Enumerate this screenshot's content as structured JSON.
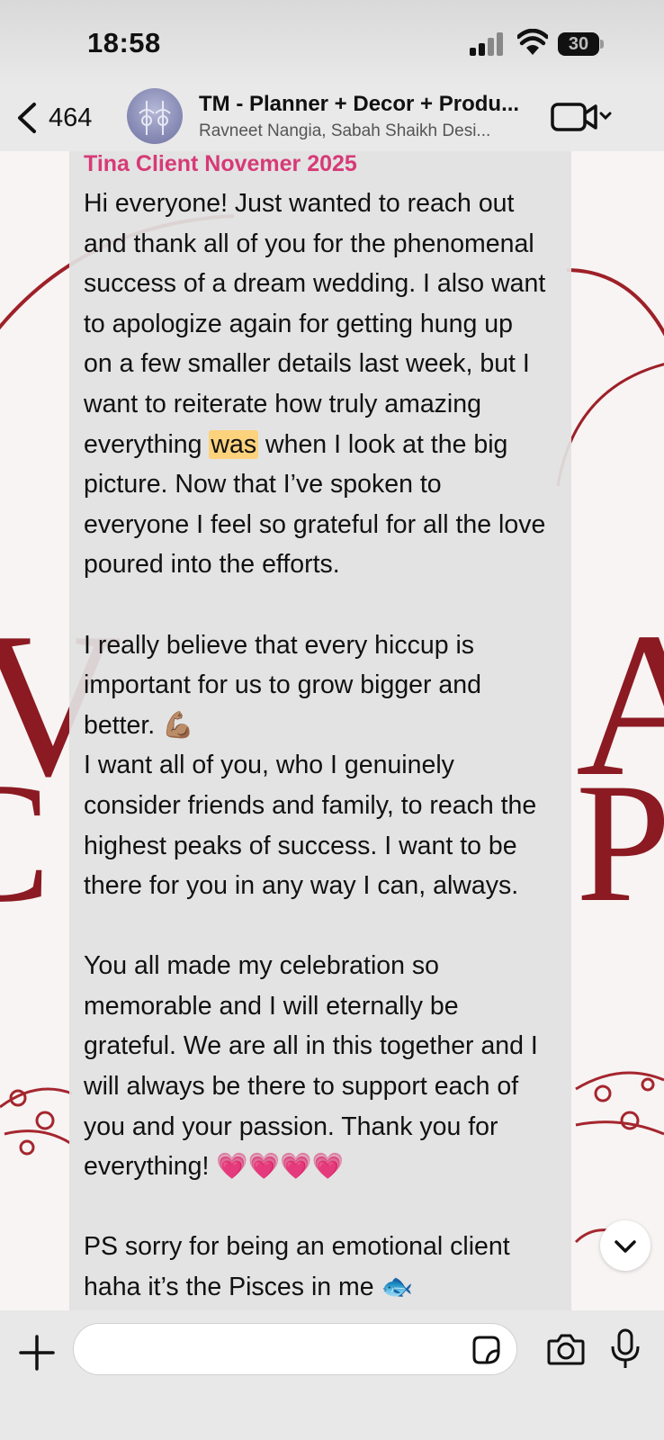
{
  "status_bar": {
    "time": "18:58",
    "battery": "30"
  },
  "header": {
    "back_count": "464",
    "title": "TM - Planner + Decor + Produ...",
    "subtitle": "Ravneet Nangia, Sabah Shaikh Desi..."
  },
  "message": {
    "sender": "Tina Client Novemer 2025",
    "sender_color": "#d63a77",
    "highlight_color": "#fcd27d",
    "lines": [
      "Hi everyone! Just wanted to reach out",
      "and thank all of you for the phenomenal",
      "success of a dream wedding. I also want",
      "to apologize again for getting hung up",
      "on a few smaller details last week, but I",
      "want to reiterate how truly amazing",
      {
        "before": "everything ",
        "highlight": "was",
        "after": " when I look at the big"
      },
      "picture. Now that I’ve spoken to",
      "everyone I feel so grateful for all the love",
      "poured into the efforts.",
      "",
      "I really believe that every hiccup is",
      "important for us to grow bigger and",
      "better. 💪🏽",
      "I want all of you, who I genuinely",
      "consider friends and family, to reach the",
      "highest peaks of success. I want to be",
      "there for you in any way I can, always.",
      "",
      "You all made my celebration so",
      "memorable and I will eternally be",
      "grateful. We are all in this together and I",
      "will always be there to support each of",
      "you and your passion. Thank you for",
      "everything! 💗💗💗💗",
      "",
      "PS sorry for being an emotional client",
      "haha it’s the Pisces in me 🐟"
    ]
  },
  "composer": {
    "placeholder": ""
  },
  "icons": [
    "back-chevron-icon",
    "group-avatar",
    "video-camera-icon",
    "plus-icon",
    "sticker-icon",
    "camera-icon",
    "microphone-icon",
    "chevron-down-icon"
  ]
}
